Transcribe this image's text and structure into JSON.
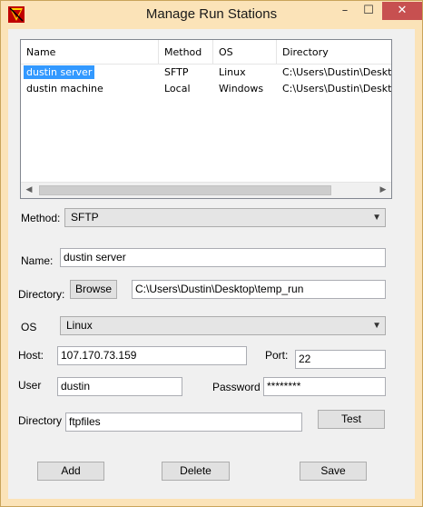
{
  "window": {
    "title": "Manage Run Stations",
    "controls": {
      "minimize": "–",
      "maximize": "☐",
      "close": "✕"
    }
  },
  "listview": {
    "columns": [
      "Name",
      "Method",
      "OS",
      "Directory"
    ],
    "rows": [
      {
        "name": "dustin server",
        "method": "SFTP",
        "os": "Linux",
        "directory": "C:\\Users\\Dustin\\Desktop",
        "selected": true
      },
      {
        "name": "dustin machine",
        "method": "Local",
        "os": "Windows",
        "directory": "C:\\Users\\Dustin\\Desktop",
        "selected": false
      }
    ],
    "scroll_left": "◀",
    "scroll_right": "▶"
  },
  "form": {
    "method_label": "Method:",
    "method_value": "SFTP",
    "name_label": "Name:",
    "name_value": "dustin server",
    "directory_label": "Directory:",
    "browse_label": "Browse",
    "directory_value": "C:\\Users\\Dustin\\Desktop\\temp_run",
    "os_label": "OS",
    "os_value": "Linux",
    "host_label": "Host:",
    "host_value": "107.170.73.159",
    "port_label": "Port:",
    "port_value": "22",
    "user_label": "User",
    "user_value": "dustin",
    "password_label": "Password",
    "password_value": "********",
    "remote_directory_label": "Directory",
    "remote_directory_value": "ftpfiles",
    "test_label": "Test",
    "dropdown_arrow": "▼"
  },
  "actions": {
    "add_label": "Add",
    "delete_label": "Delete",
    "save_label": "Save"
  },
  "colors": {
    "title_bar": "#fbe3b8",
    "close_button": "#c75050",
    "selection": "#3399ff"
  },
  "icons": {
    "app": "app-icon"
  }
}
